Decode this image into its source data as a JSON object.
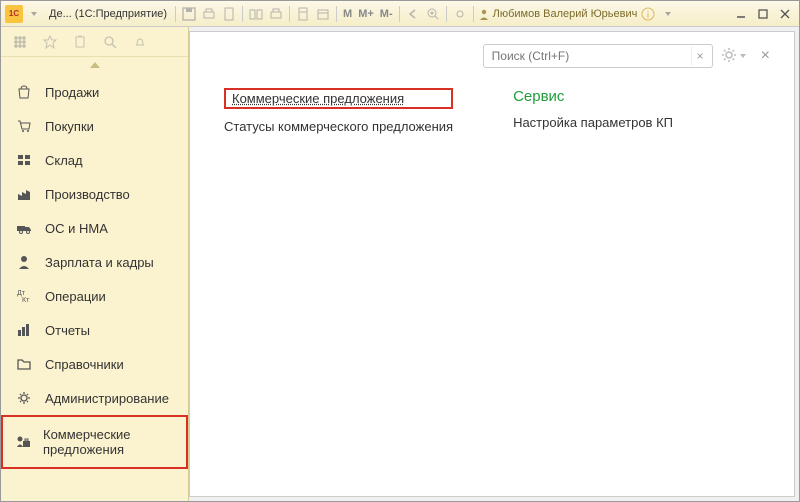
{
  "window": {
    "app_abbrev": "1С",
    "title": "Де...  (1С:Предприятие)"
  },
  "titlebar_m": {
    "m": "M",
    "mplus": "M+",
    "mminus": "M-"
  },
  "user": {
    "name": "Любимов Валерий Юрьевич"
  },
  "sidebar": {
    "items": [
      {
        "label": "Продажи"
      },
      {
        "label": "Покупки"
      },
      {
        "label": "Склад"
      },
      {
        "label": "Производство"
      },
      {
        "label": "ОС и НМА"
      },
      {
        "label": "Зарплата и кадры"
      },
      {
        "label": "Операции"
      },
      {
        "label": "Отчеты"
      },
      {
        "label": "Справочники"
      },
      {
        "label": "Администрирование"
      },
      {
        "label": "Коммерческие предложения"
      }
    ]
  },
  "search": {
    "placeholder": "Поиск (Ctrl+F)",
    "clear": "×"
  },
  "panel_close": "×",
  "main": {
    "link1": "Коммерческие предложения",
    "link2": "Статусы коммерческого предложения",
    "service_head": "Сервис",
    "service_link": "Настройка параметров КП"
  }
}
